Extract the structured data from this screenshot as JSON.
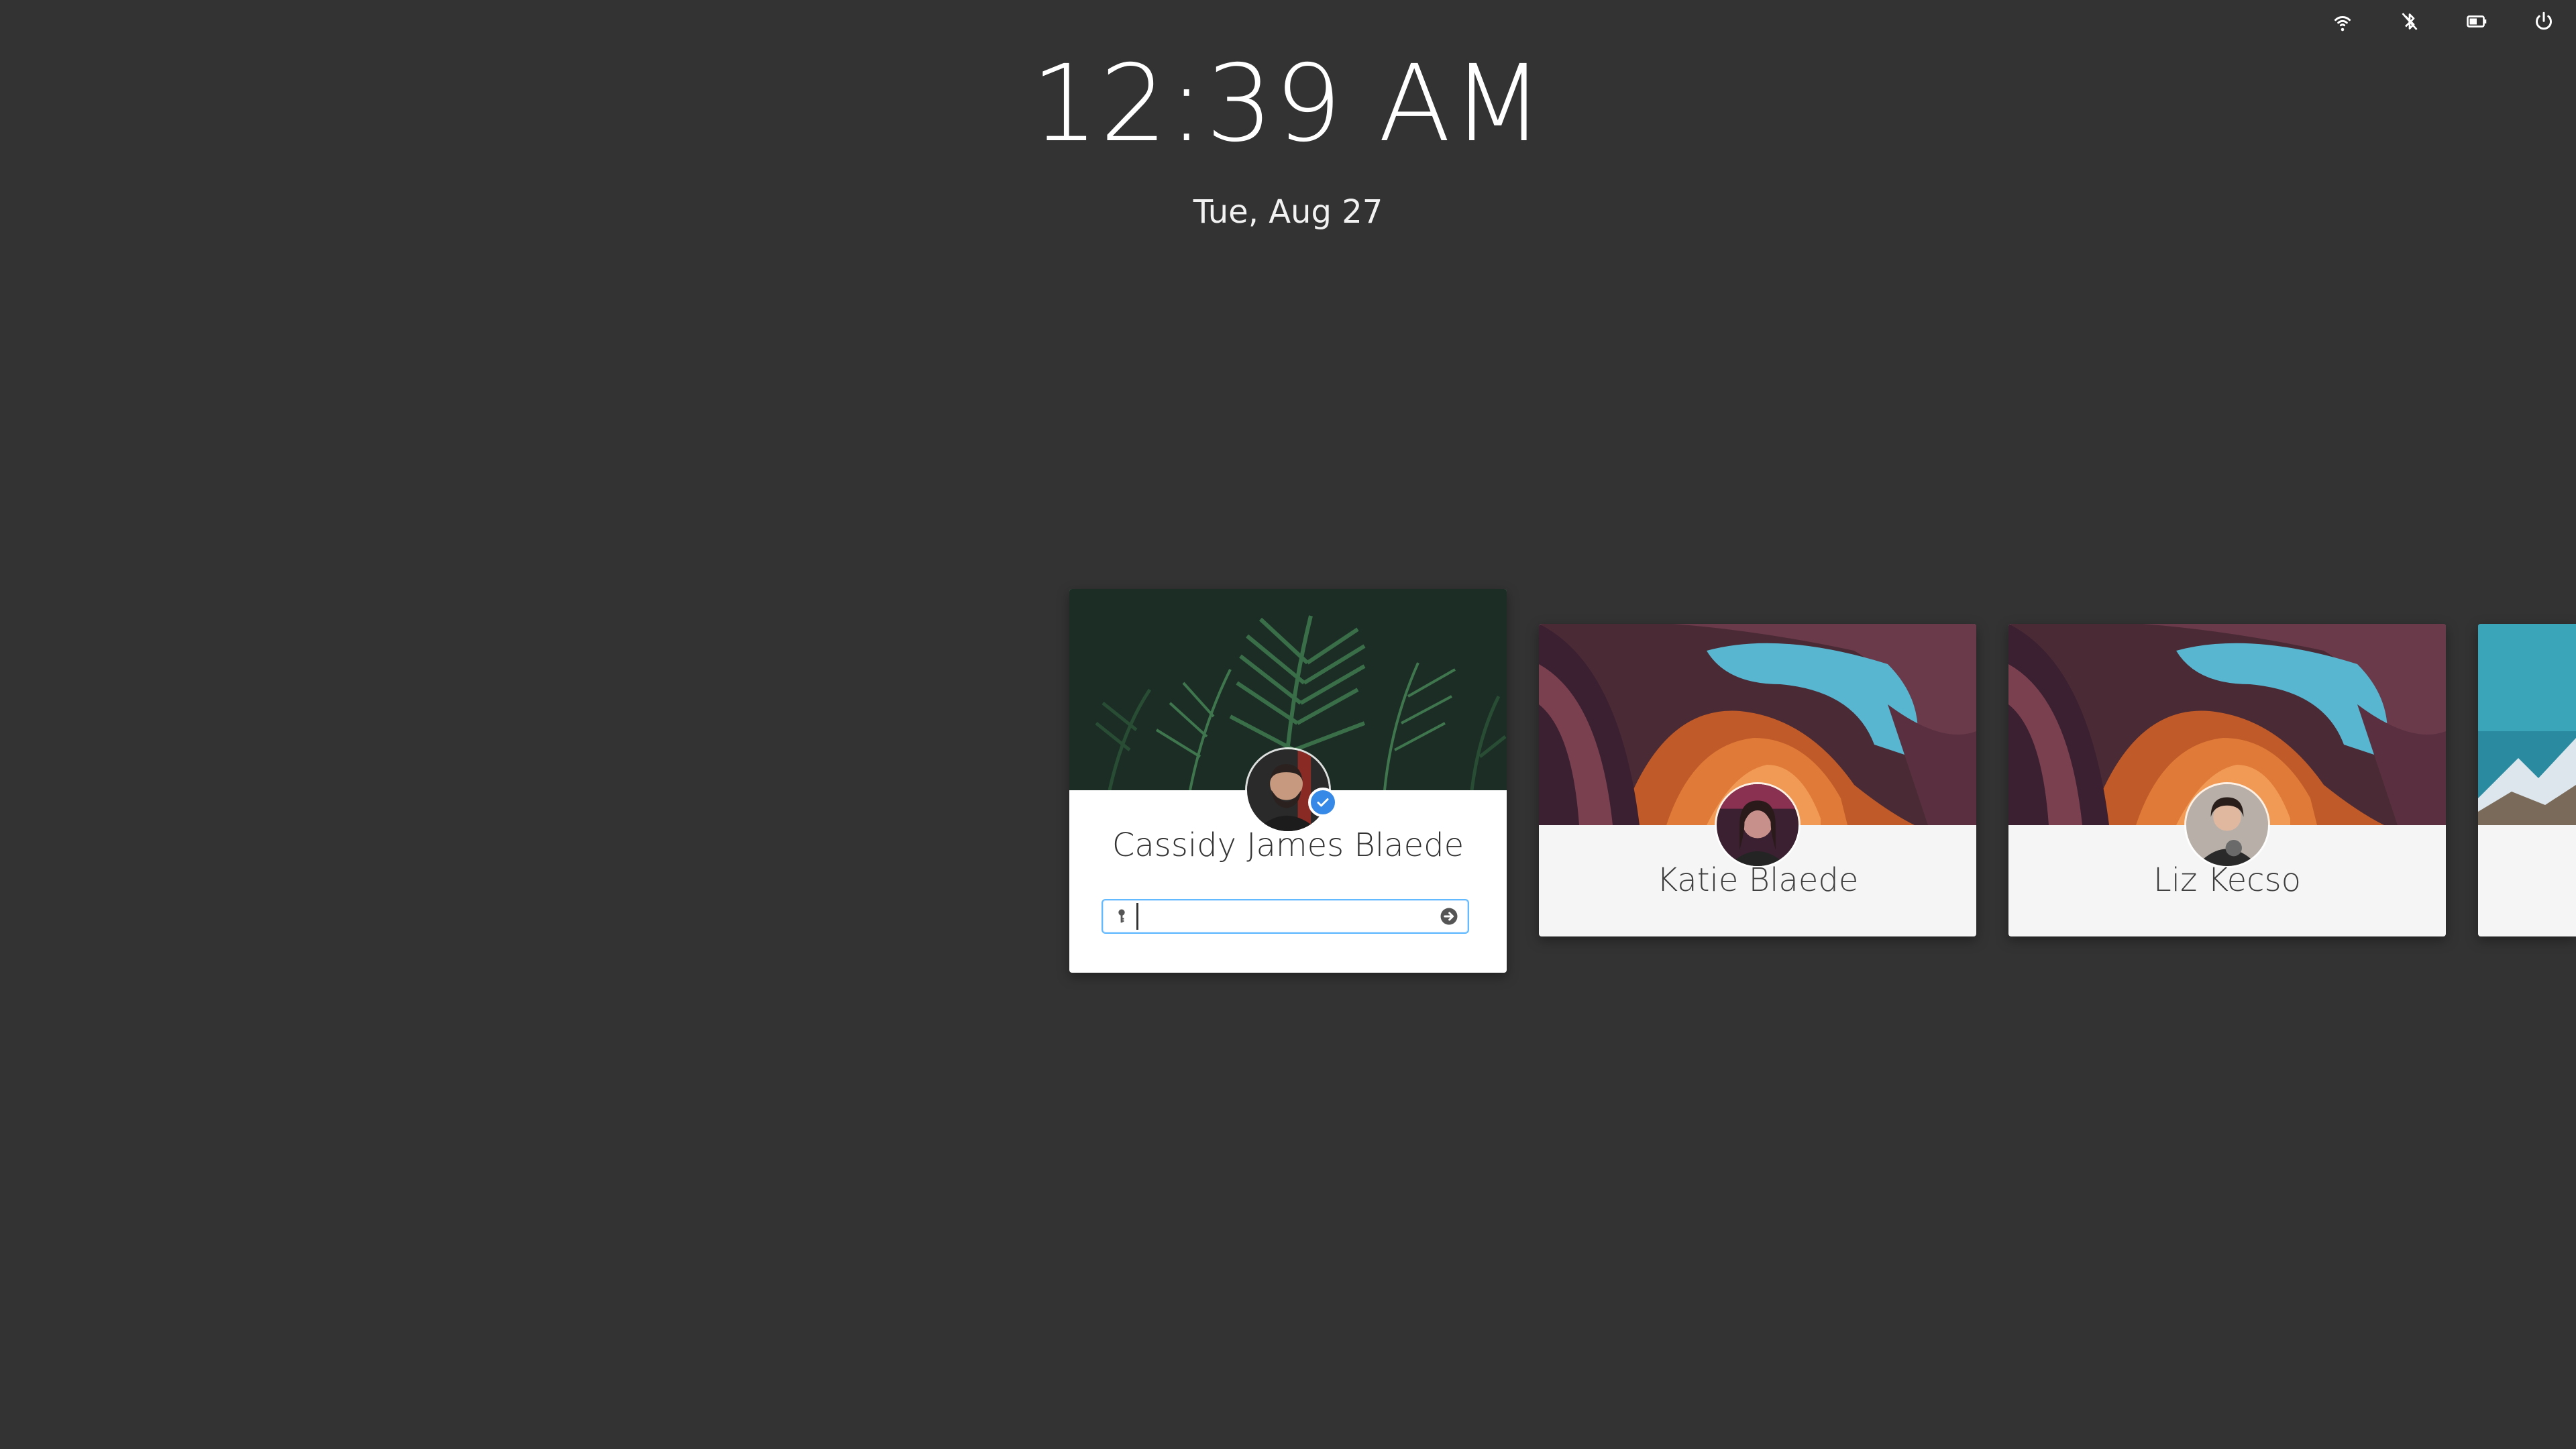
{
  "tray": {
    "icons": [
      "wifi-icon",
      "bluetooth-disabled-icon",
      "battery-icon",
      "power-icon"
    ]
  },
  "clock": {
    "time": "12:39 AM",
    "date": "Tue, Aug 27"
  },
  "users": [
    {
      "name": "Cassidy James Blaede",
      "active": true,
      "banner": "fern-leaves",
      "avatar": "man-with-beard",
      "logged_in_badge": "check-icon",
      "password": {
        "value": "",
        "key_icon": "key-icon",
        "submit_icon": "arrow-right-circle-icon"
      }
    },
    {
      "name": "Katie Blaede",
      "active": false,
      "banner": "antelope-canyon",
      "avatar": "woman-portrait"
    },
    {
      "name": "Liz Kecso",
      "active": false,
      "banner": "antelope-canyon",
      "avatar": "woman-with-cat"
    },
    {
      "name": "",
      "active": false,
      "banner": "snowy-mountains",
      "partial": true
    }
  ],
  "colors": {
    "background": "#333333",
    "accent": "#3689e6",
    "focus_ring": "#64baff",
    "card": "#f5f5f5"
  }
}
